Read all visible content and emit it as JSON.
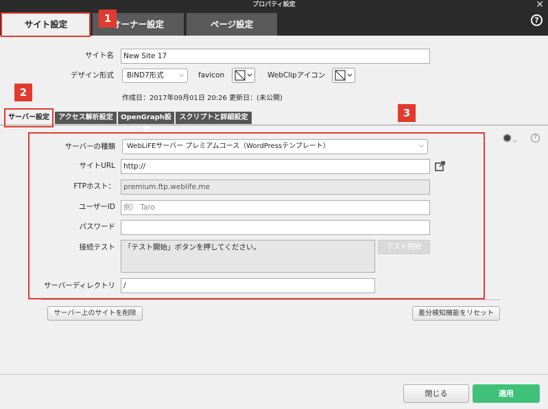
{
  "window": {
    "title": "プロパティ設定"
  },
  "tabs": [
    "サイト設定",
    "オーナー設定",
    "ページ設定"
  ],
  "callouts": [
    "1",
    "2",
    "3"
  ],
  "site": {
    "name_label": "サイト名",
    "name_value": "New Site 17",
    "design_label": "デザイン形式",
    "design_value": "BiND7形式",
    "favicon_label": "favicon",
    "webclip_label": "WebClipアイコン",
    "dates": "作成日：2017年09月01日 20:26 更新日：(未公開)"
  },
  "subtabs": [
    "サーバー設定",
    "アクセス解析設定",
    "OpenGraph設定",
    "スクリプトと詳細設定"
  ],
  "server": {
    "type_label": "サーバーの種類",
    "type_value": "WebLiFEサーバー プレミアムコース（WordPressテンプレート）",
    "url_label": "サイトURL",
    "url_value": "http://",
    "ftp_label": "FTPホスト：",
    "ftp_value": "premium.ftp.weblife.me",
    "user_label": "ユーザーID",
    "user_placeholder": "例） Taro",
    "pass_label": "パスワード",
    "pass_value": "",
    "test_label": "接続テスト",
    "test_text": "「テスト開始」ボタンを押してください。",
    "test_button": "テスト開始",
    "dir_label": "サーバーディレクトリ",
    "dir_value": "/"
  },
  "actions": {
    "delete": "サーバー上のサイトを削除",
    "reset": "差分検知機能をリセット",
    "close": "閉じる",
    "apply": "適用"
  },
  "colors": {
    "accent": "#e23a2e",
    "apply": "#3fc17a",
    "dark": "#2b2b2b"
  }
}
